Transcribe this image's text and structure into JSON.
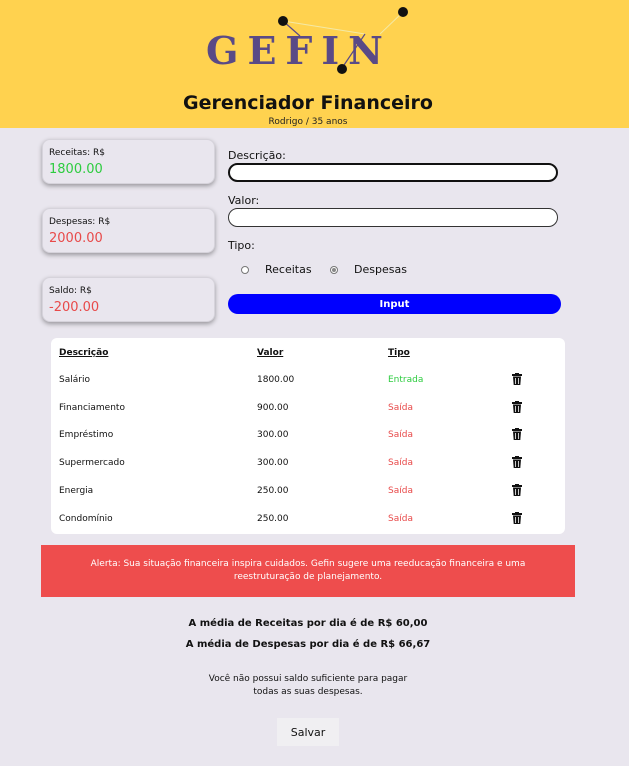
{
  "header": {
    "logo_text": "GEFIN",
    "title": "Gerenciador Financeiro",
    "subtitle": "Rodrigo / 35 anos"
  },
  "colors": {
    "header_bg": "#ffd24f",
    "logo": "#5a4a86",
    "income": "#2ecc40",
    "expense": "#e84a4a",
    "primary_button": "#0000ff",
    "alert_bg": "#ee4d4d",
    "page_bg": "#e9e6ee"
  },
  "summary": {
    "income_label": "Receitas: R$",
    "income_value": "1800.00",
    "expense_label": "Despesas: R$",
    "expense_value": "2000.00",
    "balance_label": "Saldo: R$",
    "balance_value": "-200.00"
  },
  "form": {
    "description_label": "Descrição:",
    "description_value": "",
    "value_label": "Valor:",
    "value_value": "",
    "type_label": "Tipo:",
    "type_options": [
      "Receitas",
      "Despesas"
    ],
    "type_selected": "Despesas",
    "submit_label": "Input"
  },
  "table": {
    "headers": [
      "Descrição",
      "Valor",
      "Tipo"
    ],
    "rows": [
      {
        "description": "Salário",
        "value": "1800.00",
        "type": "Entrada",
        "kind": "income"
      },
      {
        "description": "Financiamento",
        "value": "900.00",
        "type": "Saída",
        "kind": "expense"
      },
      {
        "description": "Empréstimo",
        "value": "300.00",
        "type": "Saída",
        "kind": "expense"
      },
      {
        "description": "Supermercado",
        "value": "300.00",
        "type": "Saída",
        "kind": "expense"
      },
      {
        "description": "Energia",
        "value": "250.00",
        "type": "Saída",
        "kind": "expense"
      },
      {
        "description": "Condomínio",
        "value": "250.00",
        "type": "Saída",
        "kind": "expense"
      }
    ],
    "delete_icon": "trash-icon"
  },
  "alert": {
    "text": "Alerta: Sua situação financeira inspira cuidados. Gefin sugere uma reeducação financeira e uma reestruturação de planejamento."
  },
  "averages": {
    "income_avg": "A média de Receitas por dia é de R$ 60,00",
    "expense_avg": "A média de Despesas por dia é de R$ 66,67"
  },
  "note": {
    "line1": "Você não possui saldo suficiente para pagar",
    "line2": "todas as suas despesas."
  },
  "save_label": "Salvar"
}
